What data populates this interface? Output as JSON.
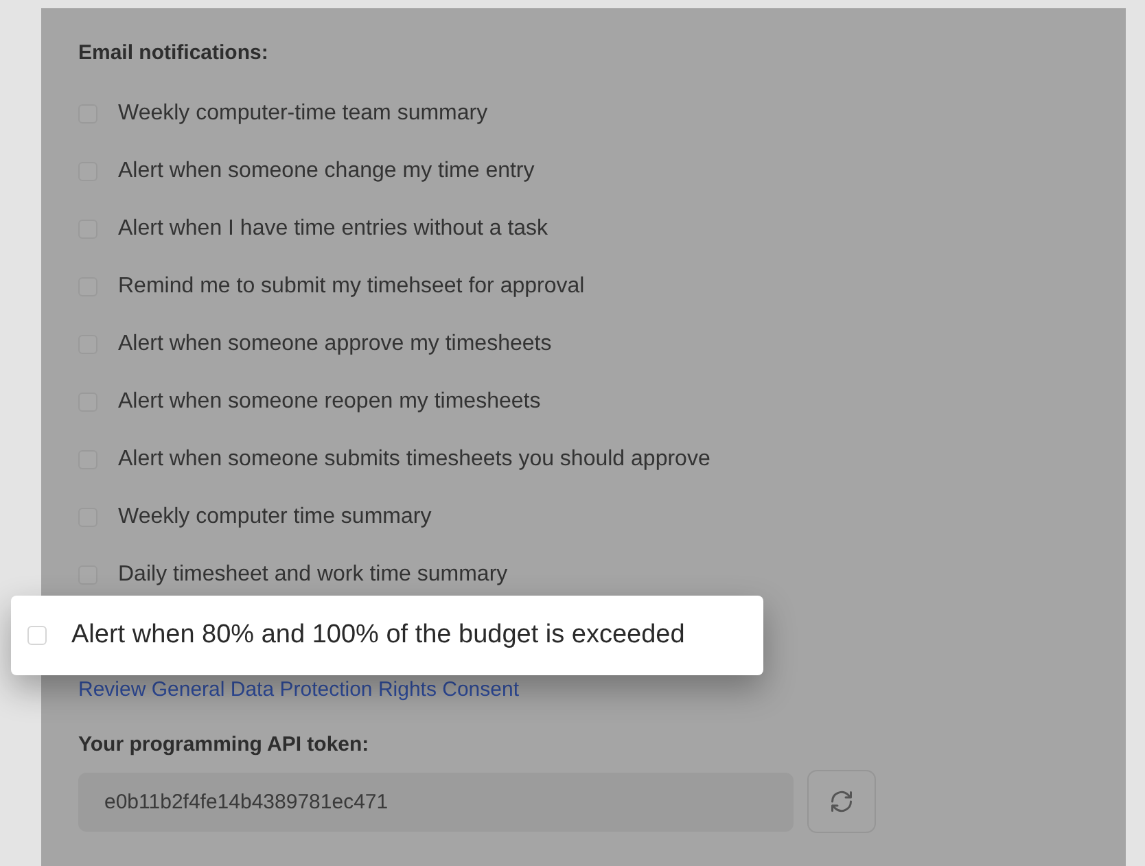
{
  "section_title": "Email notifications:",
  "options": [
    {
      "label": "Weekly computer-time team summary",
      "checked": false
    },
    {
      "label": "Alert when someone change my time entry",
      "checked": false
    },
    {
      "label": "Alert when I have time entries without a task",
      "checked": false
    },
    {
      "label": "Remind me to submit my timehseet for approval",
      "checked": false
    },
    {
      "label": "Alert when someone approve my timesheets",
      "checked": false
    },
    {
      "label": "Alert when someone reopen my timesheets",
      "checked": false
    },
    {
      "label": "Alert when someone submits timesheets you should approve",
      "checked": false
    },
    {
      "label": "Weekly computer time summary",
      "checked": false
    },
    {
      "label": "Daily timesheet and work time summary",
      "checked": false
    }
  ],
  "highlighted_option": {
    "label": "Alert when 80% and 100% of the budget is exceeded",
    "checked": false
  },
  "consent_link": "Review General Data Protection Rights Consent",
  "token_label": "Your programming API token:",
  "token_value": "e0b11b2f4fe14b4389781ec471"
}
